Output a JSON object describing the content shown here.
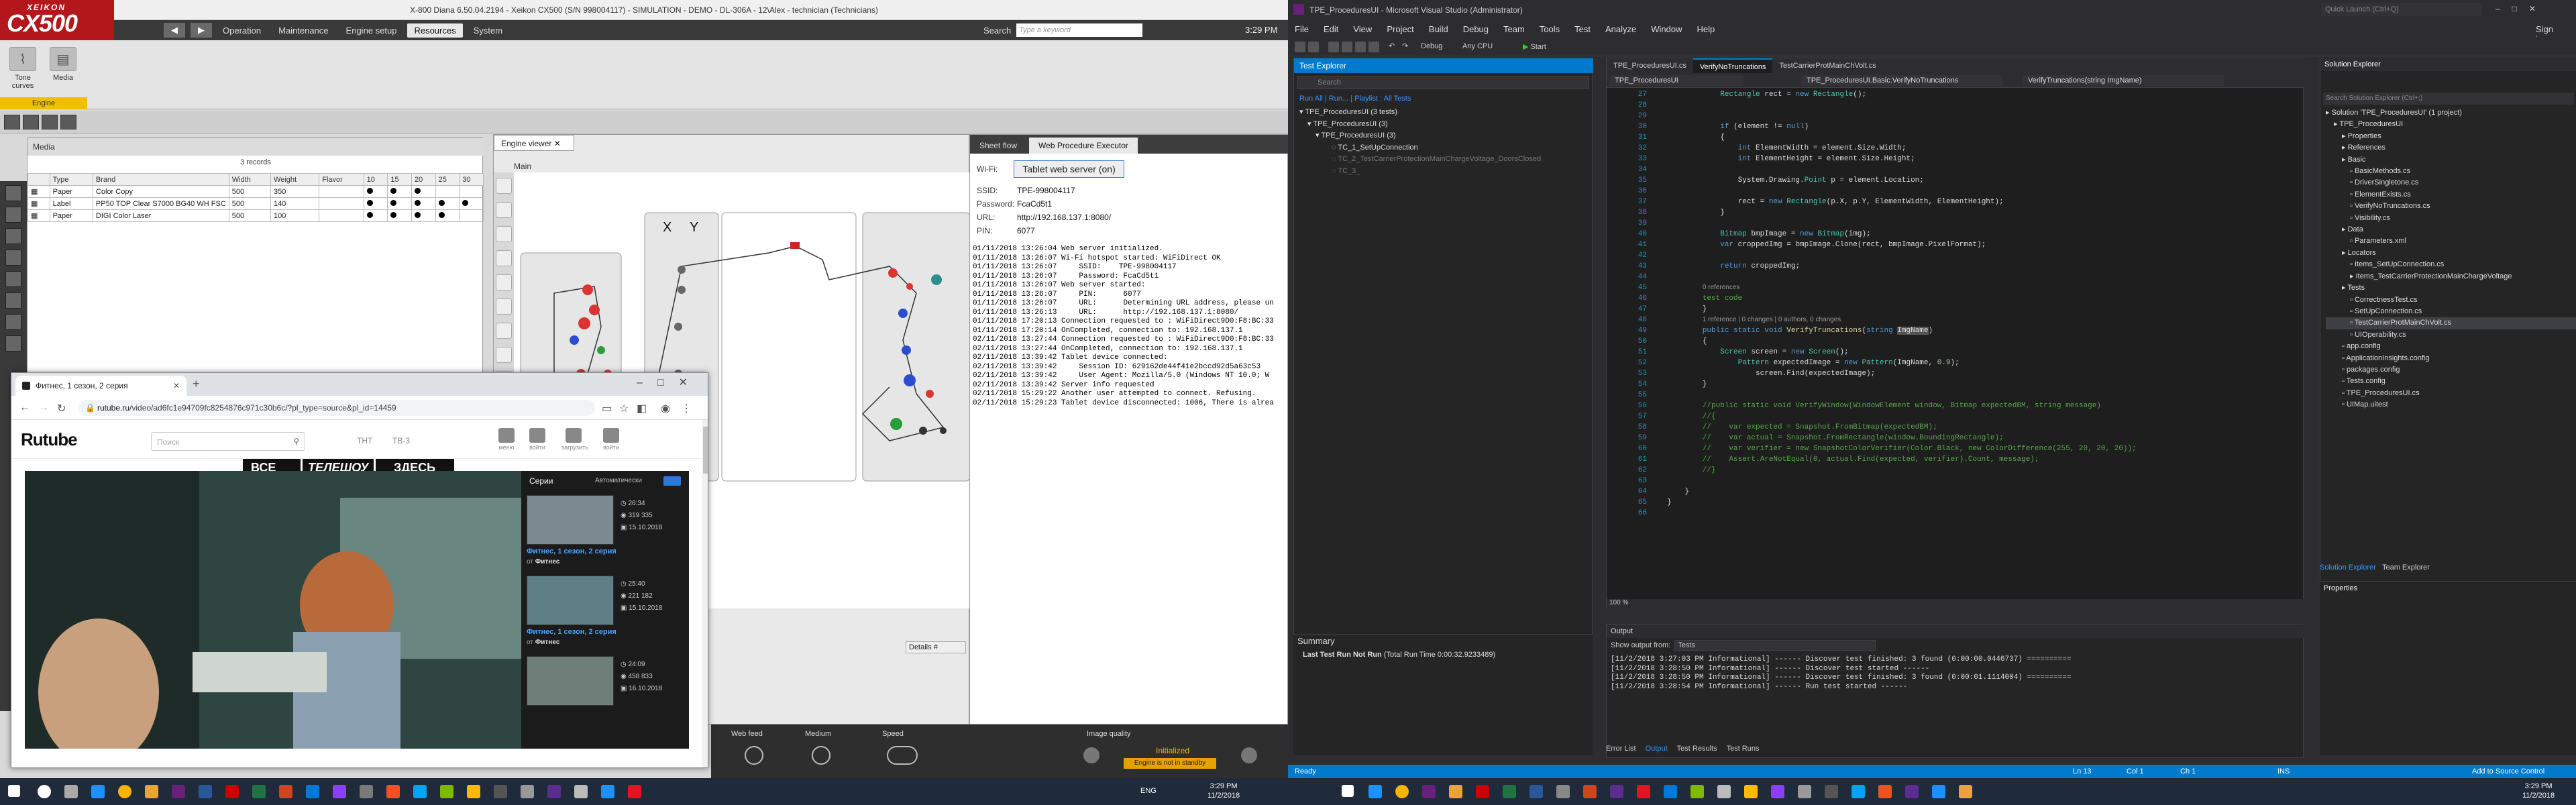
{
  "left_app": {
    "title": "X-800 Diana 6.50.04.2194 - Xeikon CX500 (S/N 998004117) - SIMULATION - DEMO - DL-306A - 12\\Alex - technician (Technicians)",
    "logo_top": "XEIKON",
    "logo_main": "CX500",
    "menu": [
      "Operation",
      "Maintenance",
      "Engine setup",
      "Resources",
      "System"
    ],
    "menu_active_index": 3,
    "search_label": "Search",
    "search_placeholder": "Type a keyword",
    "clock": "3:29 PM",
    "ribbon": {
      "tone_curves": "Tone curves",
      "media": "Media",
      "group": "Engine"
    },
    "media_panel": {
      "title": "Media",
      "record_count": "3 records",
      "columns": [
        "Type",
        "Brand",
        "Width",
        "Weight",
        "Flavor",
        "10",
        "15",
        "20",
        "25",
        "30"
      ],
      "rows": [
        {
          "type": "Paper",
          "brand": "Color Copy",
          "width": "500",
          "weight": "350"
        },
        {
          "type": "Label",
          "brand": "PP50 TOP Clear S7000 BG40 WH FSC",
          "width": "500",
          "weight": "140"
        },
        {
          "type": "Paper",
          "brand": "DIGI Color Laser",
          "width": "500",
          "weight": "100"
        }
      ]
    },
    "engine_viewer": {
      "tab": "Engine viewer",
      "main_label": "Main",
      "x_label": "X",
      "y_label": "Y"
    },
    "right_tabs": [
      "Sheet flow",
      "Web Procedure Executor"
    ],
    "right_tab_active": 1,
    "wifi": {
      "label": "Wi-Fi:",
      "button": "Tablet web server (on)",
      "ssid_k": "SSID:",
      "ssid_v": "TPE-998004117",
      "pwd_k": "Password:",
      "pwd_v": "FcaCd5t1",
      "url_k": "URL:",
      "url_v": "http://192.168.137.1:8080/",
      "pin_k": "PIN:",
      "pin_v": "6077"
    },
    "log": [
      "01/11/2018 13:26:04 Web server initialized.",
      "01/11/2018 13:26:07 Wi-Fi hotspot started: WiFiDirect OK",
      "01/11/2018 13:26:07     SSID:    TPE-998004117",
      "01/11/2018 13:26:07     Password: FcaCd5t1",
      "01/11/2018 13:26:07 Web server started:",
      "01/11/2018 13:26:07     PIN:      6077",
      "01/11/2018 13:26:07     URL:      Determining URL address, please un",
      "01/11/2018 13:26:13     URL:      http://192.168.137.1:8080/",
      "01/11/2018 17:20:13 Connection requested to : WiFiDirect9D0:F8:BC:33",
      "01/11/2018 17:20:14 OnCompleted, connection to: 192.168.137.1",
      "02/11/2018 13:27:44 Connection requested to : WiFiDirect9D0:F8:BC:33",
      "02/11/2018 13:27:44 OnCompleted, connection to: 192.168.137.1",
      "02/11/2018 13:39:42 Tablet device connected:",
      "02/11/2018 13:39:42     Session ID: 629162de44f41e2bccd92d5a63c53",
      "02/11/2018 13:39:42     User Agent: Mozilla/5.0 (Windows NT 10.0; W",
      "02/11/2018 13:39:42 Server info requested",
      "02/11/2018 15:29:22 Another user attempted to connect. Refusing.",
      "02/11/2018 15:29:23 Tablet device disconnected: 1006, There is alrea"
    ],
    "bottom": {
      "web_feed": "Web feed",
      "medium": "Medium",
      "speed": "Speed",
      "image_quality": "Image quality",
      "status_main": "Initialized",
      "status_sub": "Engine is not in standby",
      "details": "Details",
      "hash": "#"
    }
  },
  "browser": {
    "tab_title": "Фитнес, 1 сезон, 2 серия",
    "url_host": "rutube.ru",
    "url_path": "/video/ad6fc1e94709fc8254876c971c30b6c/?pl_type=source&pl_id=14459",
    "site_logo": "Rutube",
    "search_placeholder": "Поиск",
    "channels": [
      "ТНТ",
      "ТВ-3"
    ],
    "tools": [
      "меню",
      "войти",
      "загрузить",
      "войти"
    ],
    "banner_left": "ВСЕ",
    "banner_mid": "ТЕЛЕШОУ",
    "banner_right": "ЗДЕСЬ",
    "side_title": "Серии",
    "side_auto": "Автоматически",
    "items": [
      {
        "title": "Фитнес, 1 сезон, 2 серия",
        "author_prefix": "от",
        "author": "Фитнес",
        "duration": "26:34",
        "views": "319 335",
        "date": "15.10.2018"
      },
      {
        "title": "Фитнес, 1 сезон, 2 серия",
        "author_prefix": "от",
        "author": "Фитнес",
        "duration": "25:40",
        "views": "221 182",
        "date": "15.10.2018"
      },
      {
        "title": "",
        "author_prefix": "",
        "author": "",
        "duration": "24:09",
        "views": "458 833",
        "date": "16.10.2018"
      }
    ]
  },
  "vs": {
    "title": "TPE_ProceduresUI - Microsoft Visual Studio (Administrator)",
    "quick_launch": "Quick Launch (Ctrl+Q)",
    "signin": "Sign in",
    "menu": [
      "File",
      "Edit",
      "View",
      "Project",
      "Build",
      "Debug",
      "Team",
      "Tools",
      "Test",
      "Analyze",
      "Window",
      "Help"
    ],
    "toolbar_start": "Start",
    "toolbar_config": "Debug",
    "toolbar_platform": "Any CPU",
    "test_explorer": {
      "title": "Test Explorer",
      "search": "Search",
      "run_all": "Run All",
      "run": "Run...",
      "playlist": "Playlist : All Tests",
      "tree": [
        "TPE_ProceduresUI (3 tests)",
        "TPE_ProceduresUI (3)",
        "TPE_ProceduresUI (3)",
        "TC_1_SetUpConnection",
        "TC_2_TestCarrierProtectionMainChargeVoltage_DoorsClosed",
        "TC_3_"
      ],
      "summary_title": "Summary",
      "summary_line": "Last Test Run Not Run",
      "summary_time": "(Total Run Time 0:00:32.9233489)"
    },
    "editor": {
      "tabs": [
        "TPE_ProceduresUI.cs",
        "VerifyNoTruncations",
        "TestCarrierProtMainChVolt.cs"
      ],
      "active_tab": 1,
      "nav": [
        "TPE_ProceduresUI",
        "TPE_ProceduresUI.Basic.VerifyNoTruncations",
        "VerifyTruncations(string ImgName)"
      ],
      "line_start": 27,
      "zoom": "100 %"
    },
    "output": {
      "title": "Output",
      "show_from_label": "Show output from:",
      "show_from_value": "Tests",
      "lines": [
        "[11/2/2018 3:27:03 PM Informational] ------ Discover test finished: 3 found (0:00:00.0446737) ==========",
        "[11/2/2018 3:28:50 PM Informational] ------ Discover test started ------",
        "[11/2/2018 3:28:50 PM Informational] ------ Discover test finished: 3 found (0:00:01.1114004) ==========",
        "[11/2/2018 3:28:54 PM Informational] ------ Run test started ------"
      ],
      "tabs": [
        "Error List",
        "Output",
        "Test Results",
        "Test Runs"
      ],
      "active_tab": 1
    },
    "solution_explorer": {
      "title": "Solution Explorer",
      "search": "Search Solution Explorer (Ctrl+;)",
      "tree": [
        "Solution 'TPE_ProceduresUI' (1 project)",
        "TPE_ProceduresUI",
        "Properties",
        "References",
        "Basic",
        "BasicMethods.cs",
        "DriverSingletone.cs",
        "ElementExists.cs",
        "VerifyNoTruncations.cs",
        "Visibility.cs",
        "Data",
        "Parameters.xml",
        "Locators",
        "Items_SetUpConnection.cs",
        "Items_TestCarrierProtectionMainChargeVoltage",
        "Tests",
        "CorrectnessTest.cs",
        "SetUpConnection.cs",
        "TestCarrierProtMainChVolt.cs",
        "UIOperability.cs",
        "app.config",
        "ApplicationInsights.config",
        "packages.config",
        "Tests.config",
        "TPE_ProceduresUI.cs",
        "UIMap.uitest"
      ],
      "tabs": [
        "Solution Explorer",
        "Team Explorer"
      ],
      "properties": "Properties"
    },
    "status": {
      "ready": "Ready",
      "ln": "Ln 13",
      "col": "Col 1",
      "ch": "Ch 1",
      "ins": "INS",
      "source_control": "Add to Source Control"
    }
  },
  "taskbar": {
    "time": "3:29 PM",
    "date": "11/2/2018",
    "lang": "ENG",
    "time2": "3:29 PM",
    "date2": "11/2/2018"
  }
}
